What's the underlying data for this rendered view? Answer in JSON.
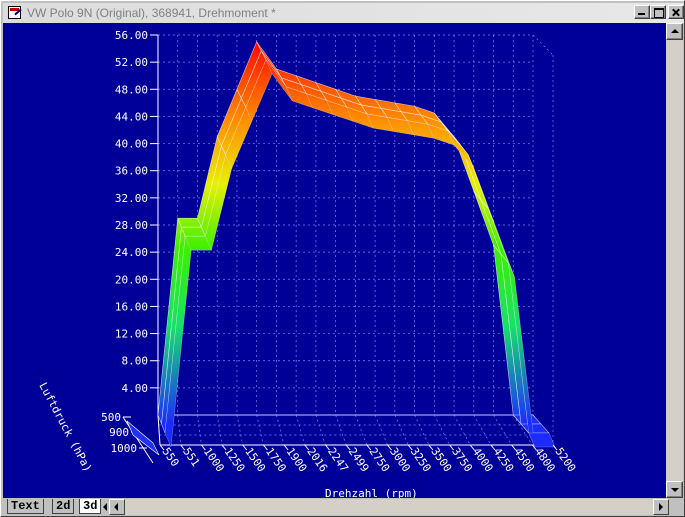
{
  "window": {
    "title": "VW Polo 9N (Original), 368941, Drehmoment *",
    "icon": "map-editor-icon"
  },
  "tabs": [
    {
      "label": "Text"
    },
    {
      "label": "2d"
    },
    {
      "label": "3d"
    }
  ],
  "colors": {
    "plot_background": "#000099",
    "grid": "#8080ff",
    "axis_text": "#ffffff"
  },
  "chart_data": {
    "type": "surface",
    "ylabel_ticks": [
      "56.00",
      "52.00",
      "48.00",
      "44.00",
      "40.00",
      "36.00",
      "32.00",
      "28.00",
      "24.00",
      "20.00",
      "16.00",
      "12.00",
      "8.00",
      "4.00"
    ],
    "ylim": [
      0,
      56
    ],
    "x_axis_label": "Drehzahl (rpm)",
    "x": [
      550,
      551,
      1000,
      1250,
      1500,
      1750,
      1900,
      2016,
      2247,
      2499,
      2750,
      3000,
      3250,
      3500,
      3750,
      4000,
      4250,
      4500,
      4800,
      5200
    ],
    "x_tick_labels": [
      "550",
      "551",
      "1000",
      "1250",
      "1500",
      "1750",
      "1900",
      "2016",
      "2247",
      "2499",
      "2750",
      "3000",
      "3250",
      "3500",
      "3750",
      "4000",
      "4250",
      "4500",
      "4800",
      "5200"
    ],
    "depth_axis_label": "Luftdruck (hPa)",
    "depth": [
      500,
      900,
      1000
    ],
    "depth_tick_labels": [
      "500",
      "900",
      "1000"
    ],
    "values_front": [
      0,
      29,
      29,
      41,
      48,
      55,
      51,
      50,
      49,
      48,
      47,
      46.5,
      46,
      45.5,
      44.5,
      41,
      33,
      25,
      0,
      0
    ],
    "grid": true
  }
}
